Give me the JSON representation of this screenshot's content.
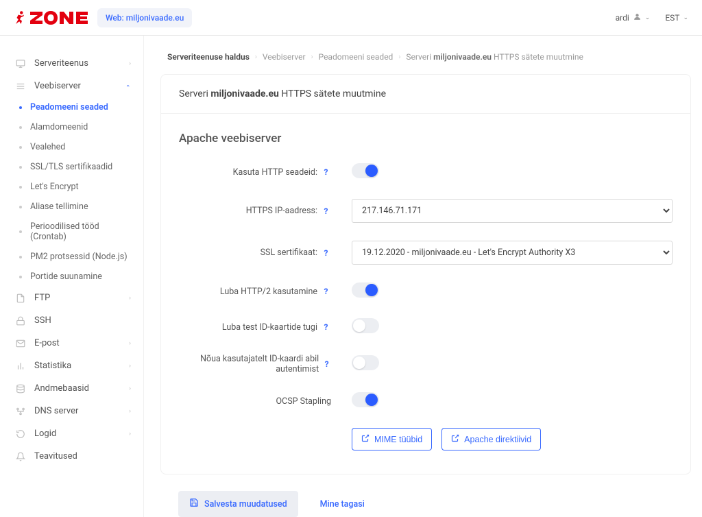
{
  "header": {
    "domain_chip_prefix": "Web: ",
    "domain_chip_value": "miljonivaade.eu",
    "user": "ardi",
    "lang": "EST"
  },
  "sidebar": {
    "items": [
      {
        "label": "Serveriteenus",
        "icon": "monitor",
        "hasArrow": true
      },
      {
        "label": "Veebiserver",
        "icon": "stack",
        "hasArrow": true,
        "expanded": true,
        "sub": [
          {
            "label": "Peadomeeni seaded",
            "active": true
          },
          {
            "label": "Alamdomeenid"
          },
          {
            "label": "Vealehed"
          },
          {
            "label": "SSL/TLS sertifikaadid"
          },
          {
            "label": "Let's Encrypt"
          },
          {
            "label": "Aliase tellimine"
          },
          {
            "label": "Perioodilised tööd (Crontab)"
          },
          {
            "label": "PM2 protsessid (Node.js)"
          },
          {
            "label": "Portide suunamine"
          }
        ]
      },
      {
        "label": "FTP",
        "icon": "file",
        "hasArrow": true
      },
      {
        "label": "SSH",
        "icon": "lock"
      },
      {
        "label": "E-post",
        "icon": "mail",
        "hasArrow": true
      },
      {
        "label": "Statistika",
        "icon": "chart",
        "hasArrow": true
      },
      {
        "label": "Andmebaasid",
        "icon": "db",
        "hasArrow": true
      },
      {
        "label": "DNS server",
        "icon": "dns",
        "hasArrow": true
      },
      {
        "label": "Logid",
        "icon": "clock",
        "hasArrow": true
      },
      {
        "label": "Teavitused",
        "icon": "bell"
      }
    ]
  },
  "breadcrumb": {
    "b1": "Serveriteenuse haldus",
    "b2": "Veebiserver",
    "b3": "Peadomeeni seaded",
    "b4_prefix": "Serveri ",
    "b4_domain": "miljonivaade.eu",
    "b4_suffix": " HTTPS sätete muutmine"
  },
  "panel": {
    "title_prefix": "Serveri ",
    "title_domain": "miljonivaade.eu",
    "title_suffix": " HTTPS sätete muutmine",
    "section_title": "Apache veebiserver",
    "fields": {
      "useHttp": {
        "label": "Kasuta HTTP seadeid:",
        "value": true
      },
      "httpsIp": {
        "label": "HTTPS IP-aadress:",
        "value": "217.146.71.171"
      },
      "sslCert": {
        "label": "SSL sertifikaat:",
        "value": "19.12.2020 - miljonivaade.eu - Let's Encrypt Authority X3"
      },
      "http2": {
        "label": "Luba HTTP/2 kasutamine",
        "value": true
      },
      "testId": {
        "label": "Luba test ID-kaartide tugi",
        "value": false
      },
      "requireId": {
        "label": "Nõua kasutajatelt ID-kaardi abil autentimist",
        "value": false
      },
      "ocsp": {
        "label": "OCSP Stapling",
        "value": true
      }
    },
    "buttons": {
      "mime": "MIME tüübid",
      "apache": "Apache direktiivid"
    }
  },
  "footer": {
    "save": "Salvesta muudatused",
    "back": "Mine tagasi"
  },
  "icons": {
    "monitor": "🖵",
    "stack": "▤",
    "file": "🗎",
    "lock": "🔒",
    "mail": "✉",
    "chart": "📊",
    "db": "🗄",
    "dns": "⚙",
    "clock": "↺",
    "bell": "🔔",
    "user": "👤",
    "edit": "↗",
    "save": "💾"
  }
}
